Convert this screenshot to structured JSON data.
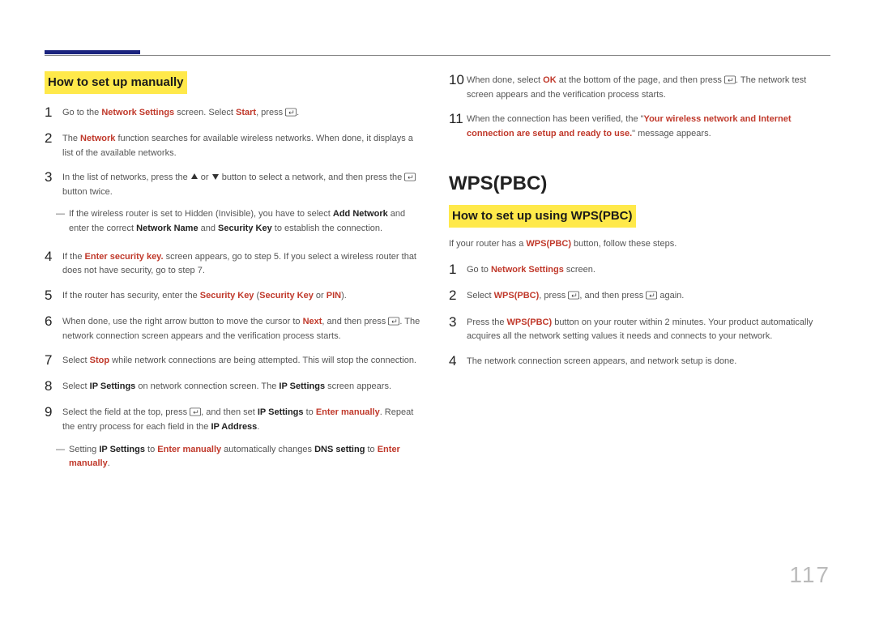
{
  "page_number": "117",
  "left": {
    "heading": "How to set up manually",
    "steps": {
      "s1a": "Go to the ",
      "s1b": "Network Settings",
      "s1c": " screen. Select ",
      "s1d": "Start",
      "s1e": ", press ",
      "s1f": ".",
      "s2a": "The ",
      "s2b": "Network",
      "s2c": " function searches for available wireless networks. When done, it displays a list of the available networks.",
      "s3a": "In the list of networks, press the ",
      "s3b": " or ",
      "s3c": " button to select a network, and then press the ",
      "s3d": " button twice.",
      "note1a": "If the wireless router is set to Hidden (Invisible), you have to select ",
      "note1b": "Add Network",
      "note1c": " and enter the correct ",
      "note1d": "Network Name",
      "note1e": " and ",
      "note1f": "Security Key",
      "note1g": " to establish the connection.",
      "s4a": "If the ",
      "s4b": "Enter security key.",
      "s4c": " screen appears, go to step 5. If you select a wireless router that does not have security, go to step 7.",
      "s5a": "If the router has security, enter the ",
      "s5b": "Security Key",
      "s5c": " (",
      "s5d": "Security Key",
      "s5e": " or ",
      "s5f": "PIN",
      "s5g": ").",
      "s6a": "When done, use the right arrow button to move the cursor to ",
      "s6b": "Next",
      "s6c": ", and then press ",
      "s6d": ". The network connection screen appears and the verification process starts.",
      "s7a": "Select ",
      "s7b": "Stop",
      "s7c": " while network connections are being attempted. This will stop the connection.",
      "s8a": "Select ",
      "s8b": "IP Settings",
      "s8c": " on network connection screen. The ",
      "s8d": "IP Settings",
      "s8e": " screen appears.",
      "s9a": "Select the field at the top, press ",
      "s9b": ", and then set ",
      "s9c": "IP Settings",
      "s9d": " to ",
      "s9e": "Enter manually",
      "s9f": ". Repeat the entry process for each field in the ",
      "s9g": "IP Address",
      "s9h": ".",
      "note2a": "Setting ",
      "note2b": "IP Settings",
      "note2c": " to ",
      "note2d": "Enter manually",
      "note2e": " automatically changes ",
      "note2f": "DNS setting",
      "note2g": " to ",
      "note2h": "Enter manually",
      "note2i": "."
    }
  },
  "right": {
    "steps_top": {
      "s10a": "When done, select ",
      "s10b": "OK",
      "s10c": " at the bottom of the page, and then press ",
      "s10d": ". The network test screen appears and the verification process starts.",
      "s11a": "When the connection has been verified, the \"",
      "s11b": "Your wireless network and Internet connection are setup and ready to use.",
      "s11c": "\" message appears."
    },
    "h1": "WPS(PBC)",
    "heading": "How to set up using WPS(PBC)",
    "intro_a": "If your router has a ",
    "intro_b": "WPS(PBC)",
    "intro_c": " button, follow these steps.",
    "steps": {
      "s1a": "Go to ",
      "s1b": "Network Settings",
      "s1c": " screen.",
      "s2a": "Select ",
      "s2b": "WPS(PBC)",
      "s2c": ", press ",
      "s2d": ", and then press ",
      "s2e": " again.",
      "s3a": "Press the ",
      "s3b": "WPS(PBC)",
      "s3c": " button on your router within 2 minutes. Your product automatically acquires all the network setting values it needs and connects to your network.",
      "s4a": "The network connection screen appears, and network setup is done."
    }
  },
  "nums": {
    "n1": "1",
    "n2": "2",
    "n3": "3",
    "n4": "4",
    "n5": "5",
    "n6": "6",
    "n7": "7",
    "n8": "8",
    "n9": "9",
    "n10": "10",
    "n11": "11"
  }
}
